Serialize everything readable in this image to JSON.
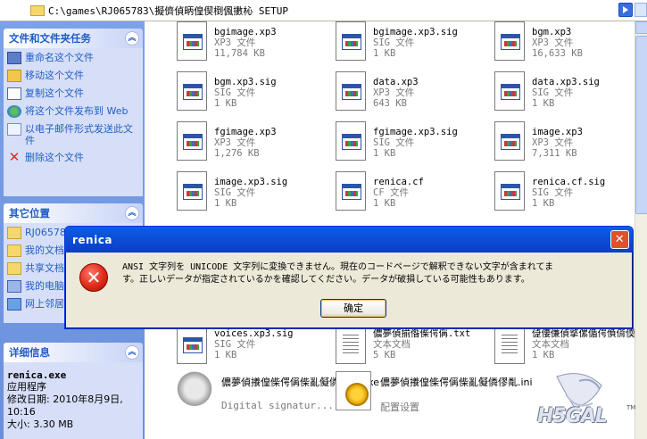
{
  "address": {
    "path": "C:\\games\\RJ065783\\擬儕偵昞偟偰椡偑擻杺  SETUP"
  },
  "tasks_panel": {
    "title": "文件和文件夹任务",
    "items": [
      {
        "label": "重命名这个文件",
        "icon": "rename-icon"
      },
      {
        "label": "移动这个文件",
        "icon": "move-icon"
      },
      {
        "label": "复制这个文件",
        "icon": "copy-icon"
      },
      {
        "label": "将这个文件发布到 Web",
        "icon": "publish-web-icon"
      },
      {
        "label": "以电子邮件形式发送此文件",
        "icon": "email-icon"
      },
      {
        "label": "删除这个文件",
        "icon": "delete-icon"
      }
    ]
  },
  "places_panel": {
    "title": "其它位置",
    "items": [
      {
        "label": "RJ065783",
        "icon": "folder-icon"
      },
      {
        "label": "我的文档",
        "icon": "my-documents-icon"
      },
      {
        "label": "共享文档",
        "icon": "shared-documents-icon"
      },
      {
        "label": "我的电脑",
        "icon": "my-computer-icon"
      },
      {
        "label": "网上邻居",
        "icon": "network-icon"
      }
    ]
  },
  "details_panel": {
    "title": "详细信息",
    "name": "renica.exe",
    "type": "应用程序",
    "modified": "修改日期: 2010年8月9日, 10:16",
    "size": "大小: 3.30 MB"
  },
  "files": [
    {
      "name": "bgimage.xp3",
      "type": "XP3 文件",
      "size": "11,784 KB"
    },
    {
      "name": "bgimage.xp3.sig",
      "type": "SIG 文件",
      "size": "1 KB"
    },
    {
      "name": "bgm.xp3",
      "type": "XP3 文件",
      "size": "16,633 KB"
    },
    {
      "name": "bgm.xp3.sig",
      "type": "SIG 文件",
      "size": "1 KB"
    },
    {
      "name": "data.xp3",
      "type": "XP3 文件",
      "size": "643 KB"
    },
    {
      "name": "data.xp3.sig",
      "type": "SIG 文件",
      "size": "1 KB"
    },
    {
      "name": "fgimage.xp3",
      "type": "XP3 文件",
      "size": "1,276 KB"
    },
    {
      "name": "fgimage.xp3.sig",
      "type": "SIG 文件",
      "size": "1 KB"
    },
    {
      "name": "image.xp3",
      "type": "XP3 文件",
      "size": "7,311 KB"
    },
    {
      "name": "image.xp3.sig",
      "type": "SIG 文件",
      "size": "1 KB"
    },
    {
      "name": "renica.cf",
      "type": "CF 文件",
      "size": "1 KB"
    },
    {
      "name": "renica.cf.sig",
      "type": "SIG 文件",
      "size": "1 KB"
    },
    {
      "name": "voices.xp3.sig",
      "type": "SIG 文件",
      "size": "1 KB"
    },
    {
      "name": "儂夢偵揃偺偨偔偁.txt",
      "type": "文本文档",
      "size": "5 KB"
    },
    {
      "name": "偼偠傔偵撉傫偱偔偩偝偄.txt",
      "type": "文本文档",
      "size": "1 KB"
    },
    {
      "name": "儂夢偵攁偟偨偔偁偨亂儗僯僇亃.exe",
      "type": "Digital signatur...",
      "size": ""
    },
    {
      "name": "儂夢偵攁偟偨偔偁偨亂儗僯僇亃.ini",
      "type": "配置设置",
      "size": ""
    }
  ],
  "dialog": {
    "title": "renica",
    "message_line1": "ANSI 文字列を UNICODE 文字列に変換できません。現在のコードページで解釈できない文字が含まれてま",
    "message_line2": "す。正しいデータが指定されているかを確認してください。データが破損している可能性もあります。",
    "ok_label": "确定",
    "close_label": "✕",
    "error_glyph": "✕"
  },
  "watermark": {
    "text": "H5GAL",
    "tm": "TM"
  }
}
